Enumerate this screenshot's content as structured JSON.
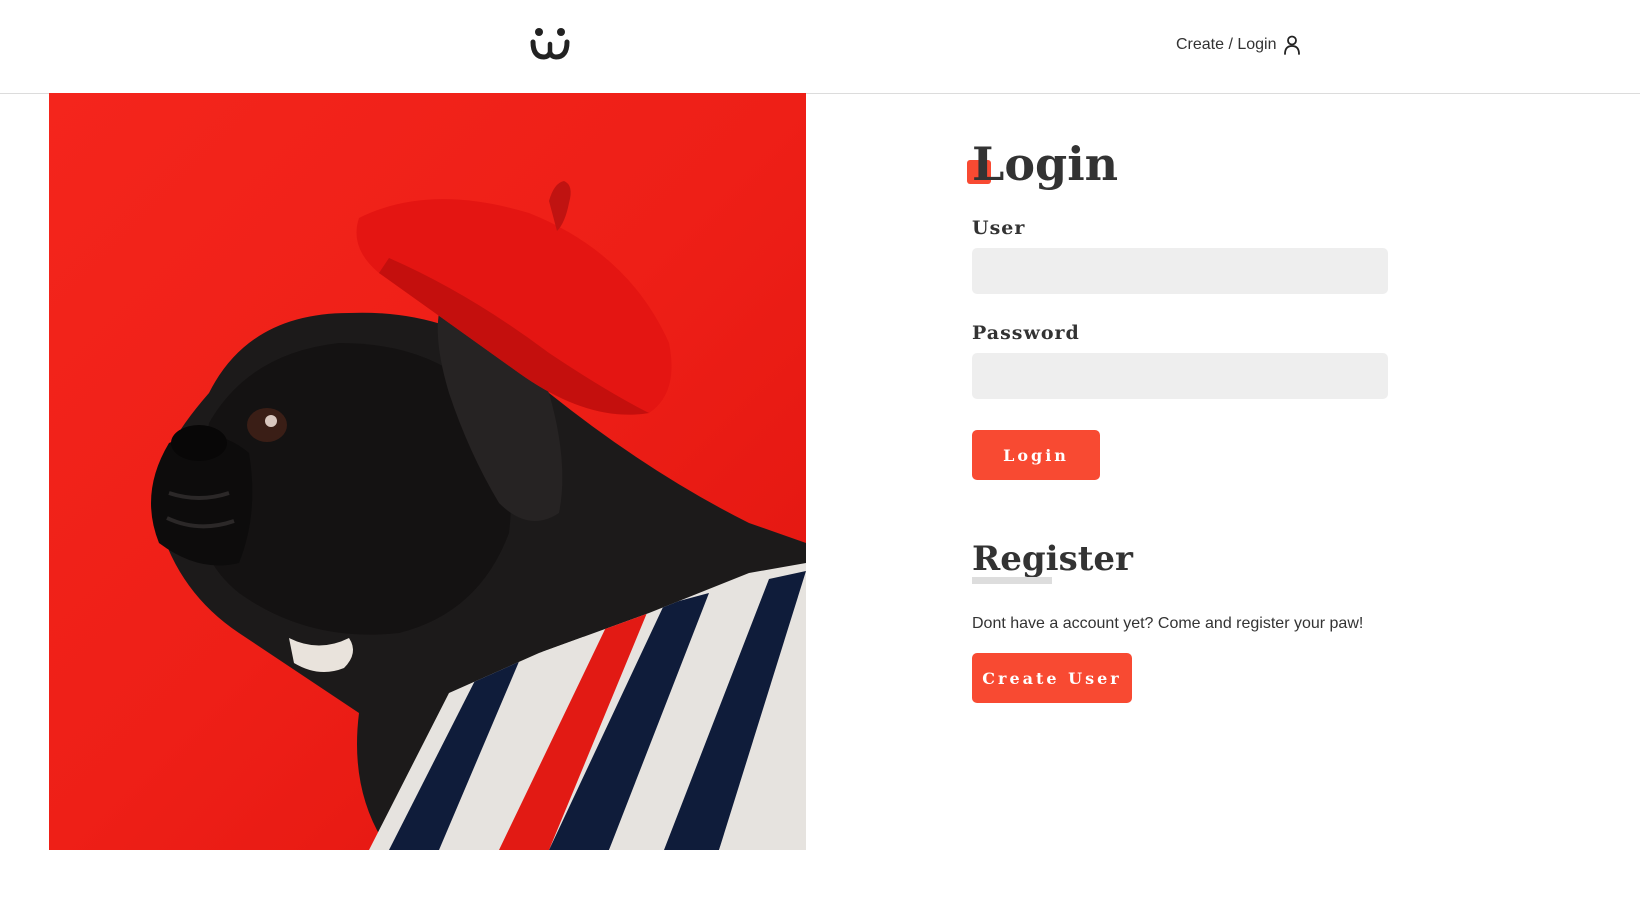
{
  "header": {
    "logo_icon": "dog-face-icon",
    "nav_login_label": "Create / Login",
    "nav_login_icon": "user-icon"
  },
  "photo": {
    "subject": "pug-in-red-beret-icon"
  },
  "login": {
    "title": "Login",
    "user_label": "User",
    "user_value": "",
    "password_label": "Password",
    "password_value": "",
    "submit_label": "Login"
  },
  "register": {
    "title": "Register",
    "text": "Dont have a account yet? Come and register your paw!",
    "button_label": "Create User"
  },
  "colors": {
    "accent": "#f84a32",
    "input_background": "#eeeeee",
    "text": "#333333",
    "divider": "#dcdcdc"
  }
}
